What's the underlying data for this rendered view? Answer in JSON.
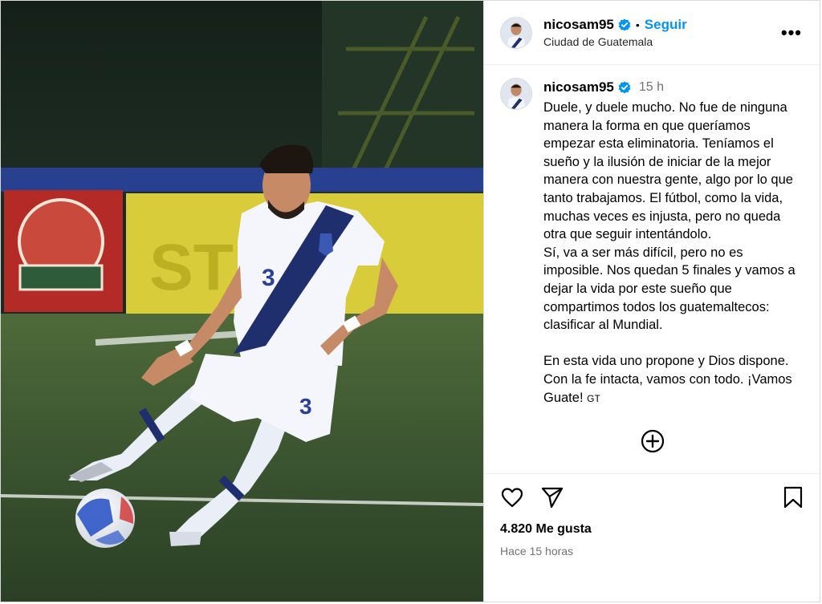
{
  "post": {
    "username": "nicosam95",
    "follow_label": "Seguir",
    "separator": "•",
    "location": "Ciudad de Guatemala",
    "more_label": "•••",
    "time_short": "15 h",
    "caption": "Duele, y duele mucho. No fue de ninguna manera la forma en que queríamos empezar esta eliminatoria. Teníamos el sueño y la ilusión de iniciar de la mejor manera con nuestra gente, algo por lo que tanto trabajamos. El fútbol, como la vida, muchas veces es injusta, pero no queda otra que seguir intentándolo.\nSí, va a ser más difícil, pero no es imposible. Nos quedan 5 finales y vamos a dejar la vida por este sueño que compartimos todos los guatemaltecos: clasificar al Mundial.\n\nEn esta vida uno propone y Dios dispone. Con la fe intacta, vamos con todo. ¡Vamos Guate! ",
    "flag_text": "GT",
    "likes": "4.820 Me gusta",
    "time_ago": "Hace 15 horas"
  },
  "photo": {
    "shirt_number": "3",
    "banner_text": "ST   US"
  },
  "icons": {
    "verified": "verified-badge-icon",
    "more": "more-options-icon",
    "add_comment": "add-circle-icon",
    "like": "heart-icon",
    "share": "paper-plane-icon",
    "save": "bookmark-icon"
  },
  "colors": {
    "accent": "#0095f6",
    "verified": "#0095f6",
    "muted": "#737373",
    "border": "#dbdbdb"
  }
}
